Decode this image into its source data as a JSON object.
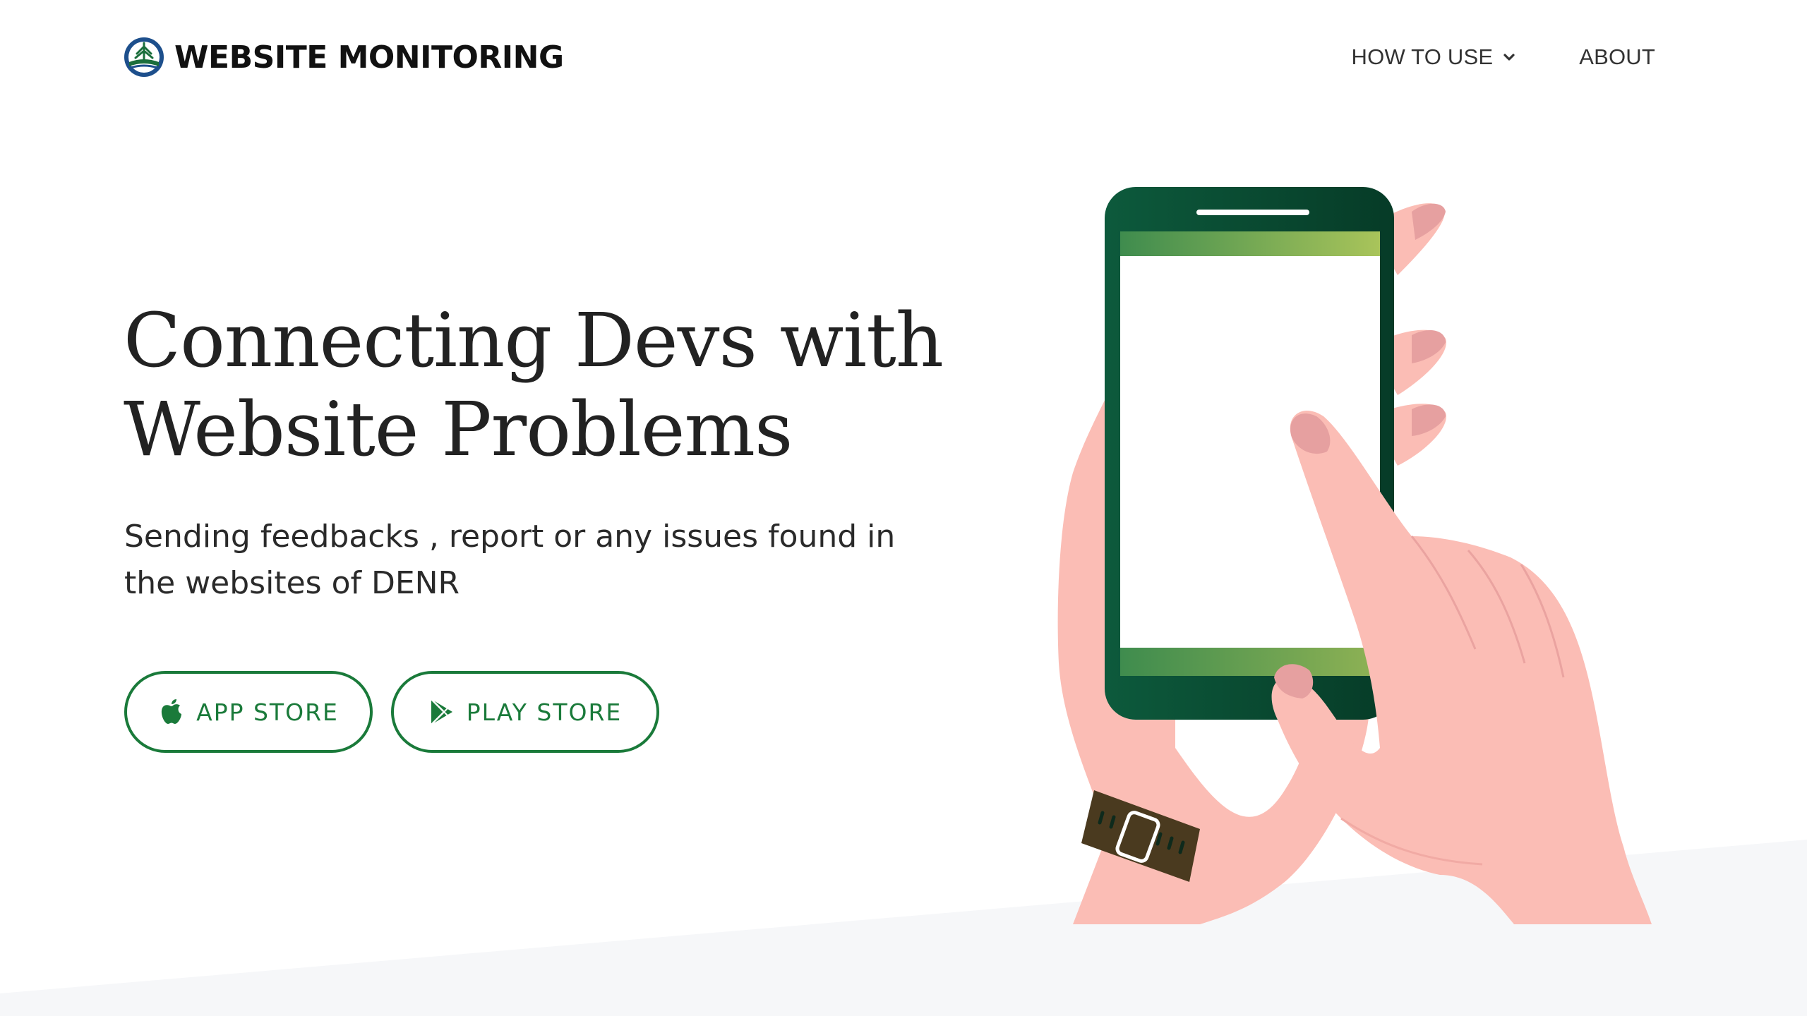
{
  "brand": {
    "name": "WEBSITE MONITORING",
    "logo_icon": "denr-seal-logo"
  },
  "nav": {
    "items": [
      {
        "label": "HOW TO USE",
        "icon": "chevron-down-icon"
      },
      {
        "label": "ABOUT"
      }
    ]
  },
  "hero": {
    "title_line1": "Connecting Devs with",
    "title_line2": "Website Problems",
    "subtitle_line1": "Sending feedbacks , report or any issues found in",
    "subtitle_line2": "the websites of DENR"
  },
  "store_buttons": {
    "app_store": {
      "label": "APP STORE",
      "icon": "apple-icon"
    },
    "play_store": {
      "label": "PLAY STORE",
      "icon": "play-store-icon"
    }
  },
  "colors": {
    "accent_green": "#1a7a3a",
    "phone_dark_green": "#0b4a33",
    "phone_bar_start": "#3f8c4e",
    "phone_bar_end": "#a9c45a",
    "skin": "#fbbdb5",
    "nail": "#e6a0a0",
    "band_gray": "#f6f7f9"
  }
}
